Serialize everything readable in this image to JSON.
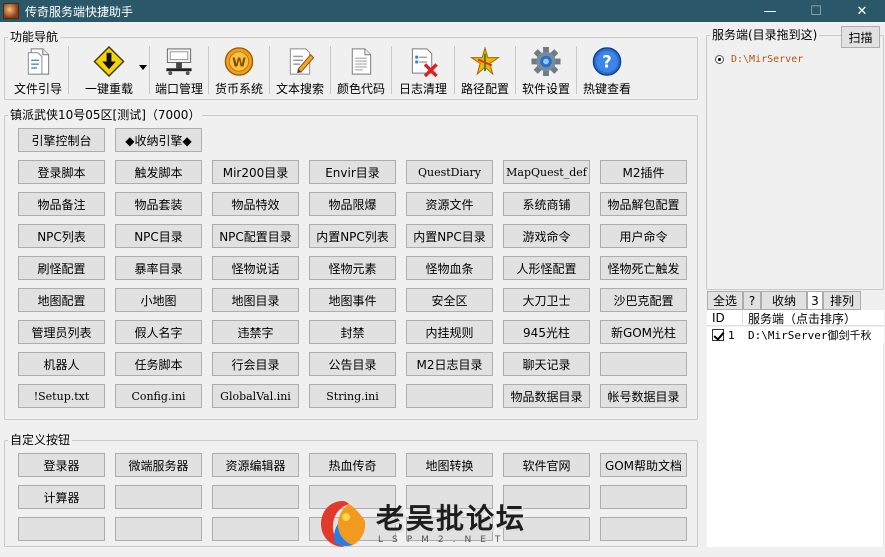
{
  "window": {
    "title": "传奇服务端快捷助手",
    "minimize": "—",
    "maximize": "☐",
    "close": "✕"
  },
  "nav": {
    "legend": "功能导航",
    "items": [
      {
        "label": "文件引导",
        "icon": "file-icon"
      },
      {
        "label": "一键重载",
        "icon": "download-icon"
      },
      {
        "label": "端口管理",
        "icon": "network-icon"
      },
      {
        "label": "货币系统",
        "icon": "coin-icon"
      },
      {
        "label": "文本搜索",
        "icon": "edit-doc-icon"
      },
      {
        "label": "颜色代码",
        "icon": "doc-icon"
      },
      {
        "label": "日志清理",
        "icon": "log-delete-icon"
      },
      {
        "label": "路径配置",
        "icon": "path-star-icon"
      },
      {
        "label": "软件设置",
        "icon": "gear-icon"
      },
      {
        "label": "热键查看",
        "icon": "help-icon"
      }
    ]
  },
  "engine": {
    "legend": "镇派武侠10号05区[测试]（7000）",
    "control": "引擎控制台",
    "collapse": "◆收纳引擎◆",
    "rows": [
      [
        "登录脚本",
        "触发脚本",
        "Mir200目录",
        "Envir目录",
        "QuestDiary",
        "MapQuest_def",
        "M2插件"
      ],
      [
        "物品备注",
        "物品套装",
        "物品特效",
        "物品限爆",
        "资源文件",
        "系统商铺",
        "物品解包配置"
      ],
      [
        "NPC列表",
        "NPC目录",
        "NPC配置目录",
        "内置NPC列表",
        "内置NPC目录",
        "游戏命令",
        "用户命令"
      ],
      [
        "刷怪配置",
        "暴率目录",
        "怪物说话",
        "怪物元素",
        "怪物血条",
        "人形怪配置",
        "怪物死亡触发"
      ],
      [
        "地图配置",
        "小地图",
        "地图目录",
        "地图事件",
        "安全区",
        "大刀卫士",
        "沙巴克配置"
      ],
      [
        "管理员列表",
        "假人名字",
        "违禁字",
        "封禁",
        "内挂规则",
        "945光柱",
        "新GOM光柱"
      ],
      [
        "机器人",
        "任务脚本",
        "行会目录",
        "公告目录",
        "M2日志目录",
        "聊天记录",
        ""
      ],
      [
        "!Setup.txt",
        "Config.ini",
        "GlobalVal.ini",
        "String.ini",
        "",
        "物品数据目录",
        "帐号数据目录"
      ]
    ]
  },
  "custom": {
    "legend": "自定义按钮",
    "rows": [
      [
        "登录器",
        "微端服务器",
        "资源编辑器",
        "热血传奇",
        "地图转换",
        "软件官网",
        "GOM帮助文档"
      ],
      [
        "计算器",
        "",
        "",
        "",
        "",
        "",
        ""
      ],
      [
        "",
        "",
        "",
        "",
        "",
        "",
        ""
      ]
    ]
  },
  "server": {
    "legend": "服务端(目录拖到这)",
    "scan": "扫描",
    "path": "D:\\MirServer"
  },
  "list": {
    "select_all": "全选",
    "help": "?",
    "collapse": "收纳",
    "count": "3",
    "sort": "排列",
    "col_id": "ID",
    "col_server": "服务端（点击排序）",
    "rows": [
      {
        "id": "1",
        "path": "D:\\MirServer御剑千秋"
      }
    ]
  },
  "watermark": {
    "cn": "老吴批论坛",
    "en": "LSPM2.NET"
  },
  "colors": {
    "titlebar": "#2b5868",
    "path_orange": "#b8540c",
    "button_face": "#e1e1e1"
  }
}
